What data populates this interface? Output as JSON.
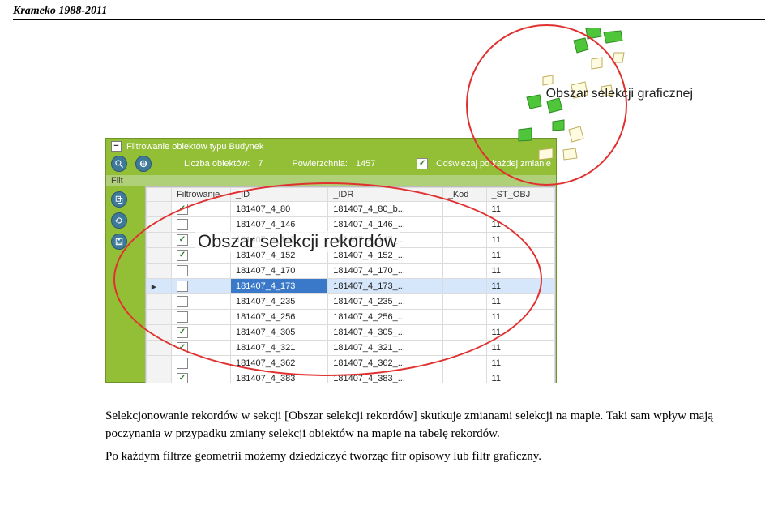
{
  "header": {
    "text": "Krameko 1988-2011"
  },
  "map": {
    "label": "Obszar selekcji graficznej",
    "circle": true
  },
  "table_selection": {
    "label": "Obszar selekcji rekordów"
  },
  "panel": {
    "title": "Filtrowanie obiektów typu Budynek",
    "stats": {
      "count_label": "Liczba obiektów:",
      "count_value": "7",
      "area_label": "Powierzchnia:",
      "area_value": "1457"
    },
    "refresh": {
      "checked": true,
      "label": "Odświeżaj po każdej zmianie"
    },
    "filt_label": "Filt",
    "columns": [
      "Filtrowanie",
      "_ID",
      "_IDR",
      "_Kod",
      "_ST_OBJ"
    ],
    "rows": [
      {
        "checked": true,
        "id": "181407_4_80",
        "idr": "181407_4_80_b...",
        "kod": "",
        "st": "11",
        "selected": false,
        "pointer": false
      },
      {
        "checked": false,
        "id": "181407_4_146",
        "idr": "181407_4_146_...",
        "kod": "",
        "st": "11",
        "selected": false,
        "pointer": false
      },
      {
        "checked": true,
        "id": "181407_4_147",
        "idr": "181407_4_147_...",
        "kod": "",
        "st": "11",
        "selected": false,
        "pointer": false
      },
      {
        "checked": true,
        "id": "181407_4_152",
        "idr": "181407_4_152_...",
        "kod": "",
        "st": "11",
        "selected": false,
        "pointer": false
      },
      {
        "checked": false,
        "id": "181407_4_170",
        "idr": "181407_4_170_...",
        "kod": "",
        "st": "11",
        "selected": false,
        "pointer": false
      },
      {
        "checked": false,
        "id": "181407_4_173",
        "idr": "181407_4_173_...",
        "kod": "",
        "st": "11",
        "selected": true,
        "pointer": true
      },
      {
        "checked": false,
        "id": "181407_4_235",
        "idr": "181407_4_235_...",
        "kod": "",
        "st": "11",
        "selected": false,
        "pointer": false
      },
      {
        "checked": false,
        "id": "181407_4_256",
        "idr": "181407_4_256_...",
        "kod": "",
        "st": "11",
        "selected": false,
        "pointer": false
      },
      {
        "checked": true,
        "id": "181407_4_305",
        "idr": "181407_4_305_...",
        "kod": "",
        "st": "11",
        "selected": false,
        "pointer": false
      },
      {
        "checked": true,
        "id": "181407_4_321",
        "idr": "181407_4_321_...",
        "kod": "",
        "st": "11",
        "selected": false,
        "pointer": false
      },
      {
        "checked": false,
        "id": "181407_4_362",
        "idr": "181407_4_362_...",
        "kod": "",
        "st": "11",
        "selected": false,
        "pointer": false
      },
      {
        "checked": true,
        "id": "181407_4_383",
        "idr": "181407_4_383_...",
        "kod": "",
        "st": "11",
        "selected": false,
        "pointer": false
      }
    ]
  },
  "body_text": {
    "p1": "Selekcjonowanie rekordów w sekcji [Obszar selekcji rekordów] skutkuje zmianami selekcji na mapie. Taki sam wpływ mają poczynania w przypadku zmiany selekcji obiektów na mapie na tabelę rekordów.",
    "p2": "Po każdym filtrze geometrii możemy dziedziczyć tworząc fitr opisowy lub filtr graficzny."
  }
}
